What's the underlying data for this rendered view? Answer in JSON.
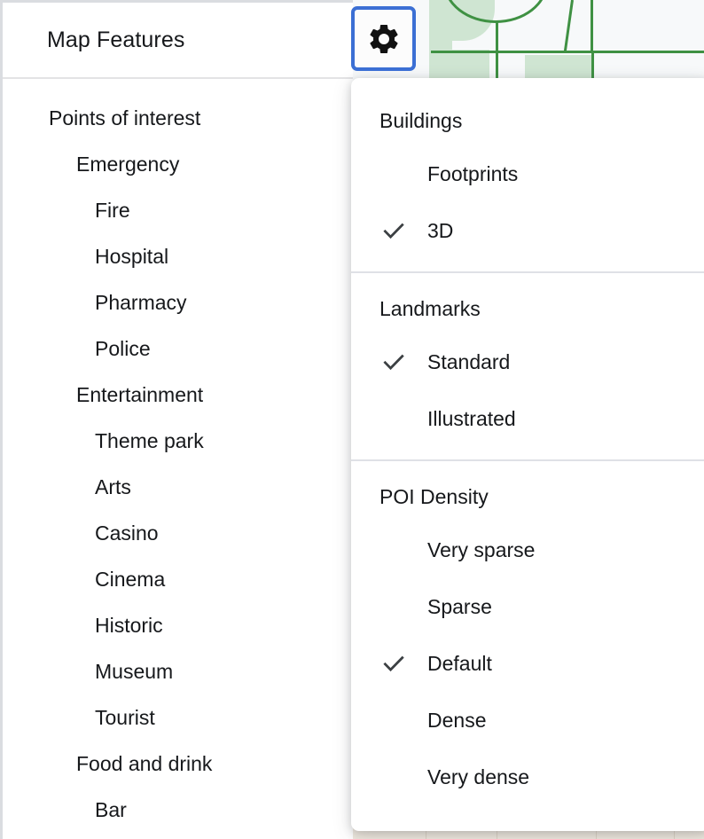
{
  "panel": {
    "title": "Map Features",
    "gear_button": {
      "icon": "gear-icon",
      "focus_ring_color": "#3b6fd4"
    },
    "tree": [
      {
        "label": "Points of interest",
        "level": 0
      },
      {
        "label": "Emergency",
        "level": 1
      },
      {
        "label": "Fire",
        "level": 2
      },
      {
        "label": "Hospital",
        "level": 2
      },
      {
        "label": "Pharmacy",
        "level": 2
      },
      {
        "label": "Police",
        "level": 2
      },
      {
        "label": "Entertainment",
        "level": 1
      },
      {
        "label": "Theme park",
        "level": 2
      },
      {
        "label": "Arts",
        "level": 2
      },
      {
        "label": "Casino",
        "level": 2
      },
      {
        "label": "Cinema",
        "level": 2
      },
      {
        "label": "Historic",
        "level": 2
      },
      {
        "label": "Museum",
        "level": 2
      },
      {
        "label": "Tourist",
        "level": 2
      },
      {
        "label": "Food and drink",
        "level": 1
      },
      {
        "label": "Bar",
        "level": 2
      }
    ]
  },
  "menu": {
    "sections": [
      {
        "title": "Buildings",
        "options": [
          {
            "label": "Footprints",
            "checked": false
          },
          {
            "label": "3D",
            "checked": true
          }
        ]
      },
      {
        "title": "Landmarks",
        "options": [
          {
            "label": "Standard",
            "checked": true
          },
          {
            "label": "Illustrated",
            "checked": false
          }
        ]
      },
      {
        "title": "POI Density",
        "options": [
          {
            "label": "Very sparse",
            "checked": false
          },
          {
            "label": "Sparse",
            "checked": false
          },
          {
            "label": "Default",
            "checked": true
          },
          {
            "label": "Dense",
            "checked": false
          },
          {
            "label": "Very dense",
            "checked": false
          }
        ]
      }
    ]
  },
  "colors": {
    "text": "#16181b",
    "divider": "#dfe1e6",
    "panel_border": "#dadce0",
    "focus_blue": "#3b6fd4",
    "check_gray": "#3c4043",
    "map_background": "#f7f9fa",
    "map_road": "#3f9143",
    "map_park": "#cfe5d2"
  }
}
